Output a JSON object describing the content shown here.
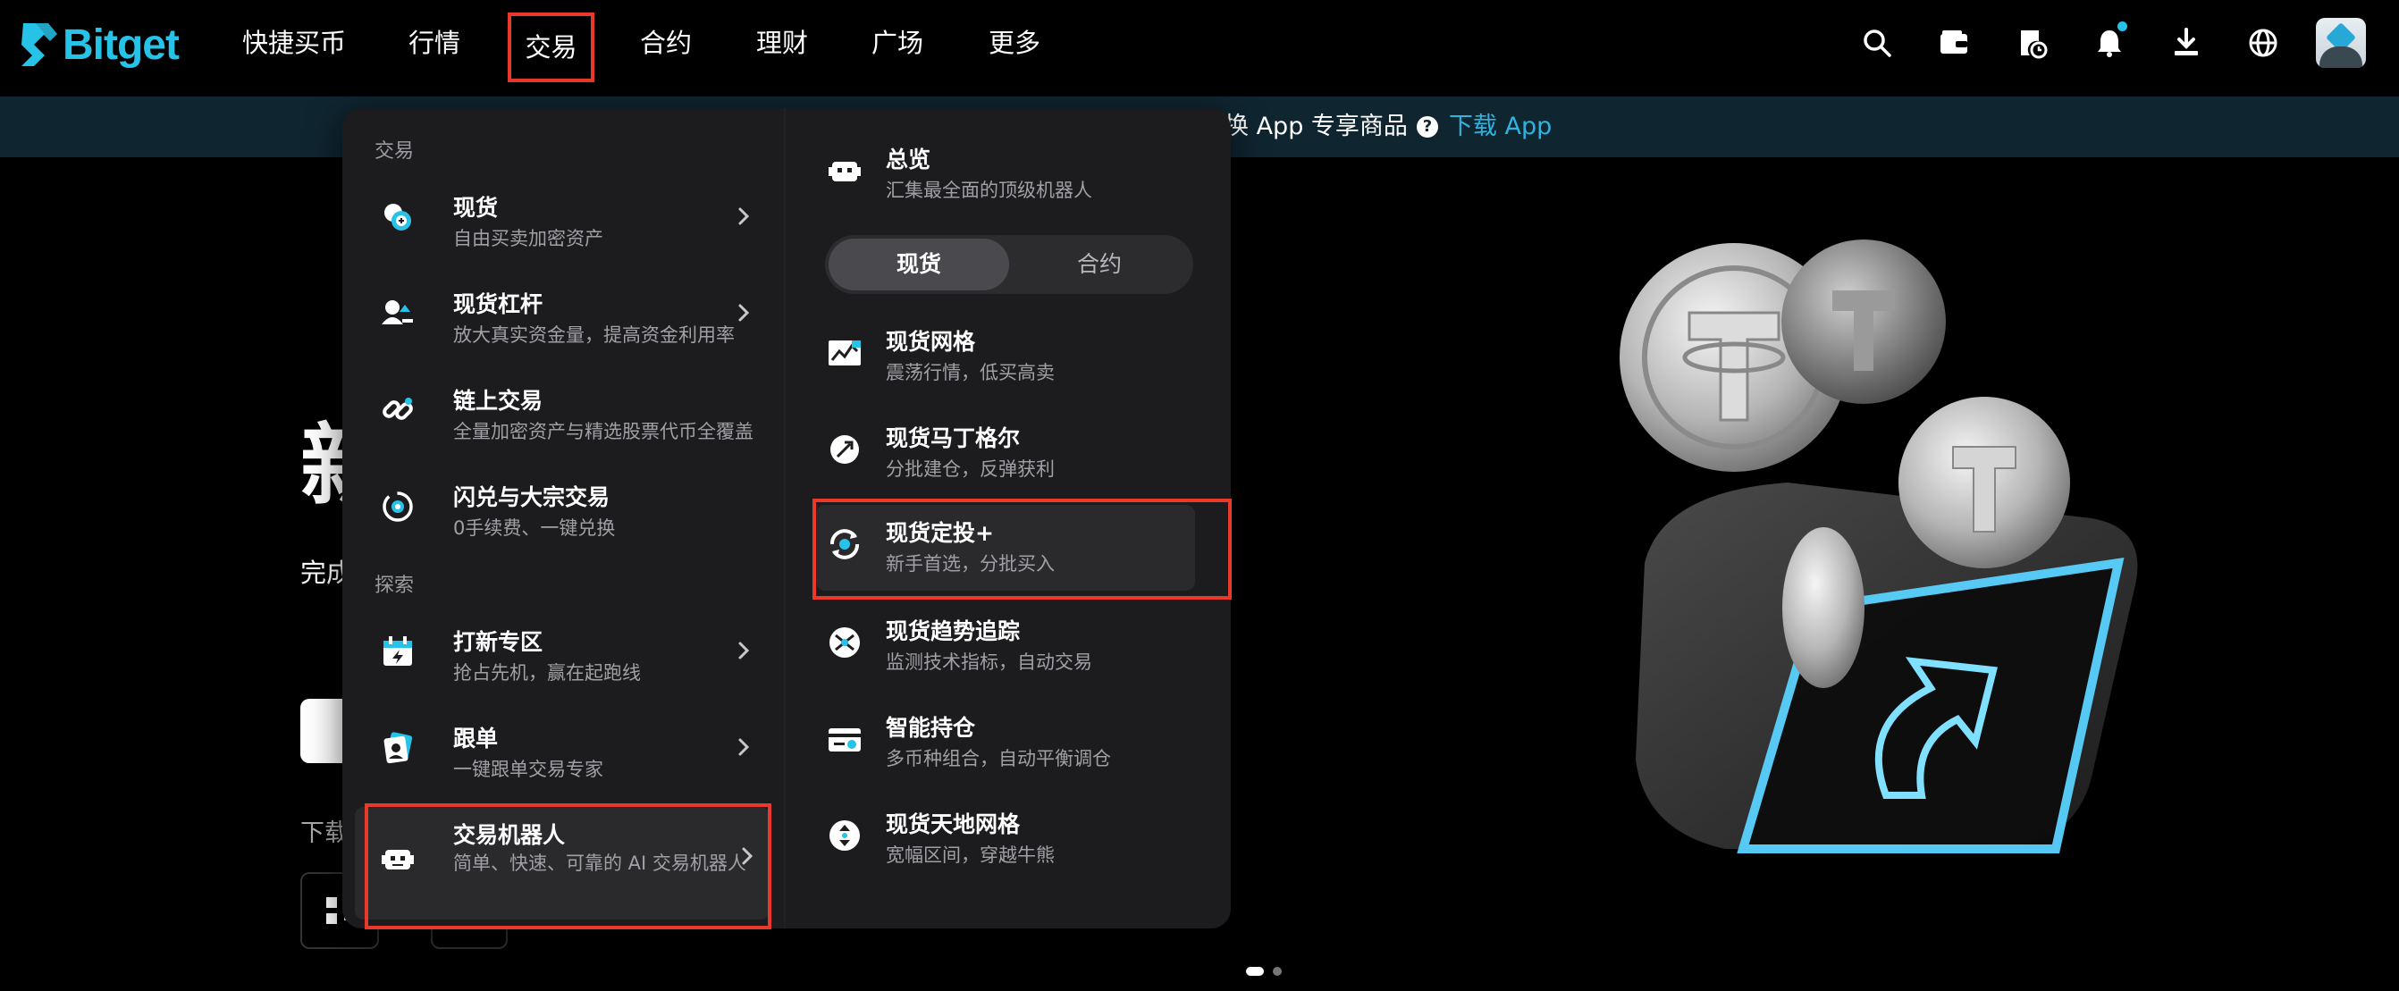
{
  "brand": {
    "name": "Bitget",
    "accent": "#27c2e8",
    "highlight": "#e8392b"
  },
  "nav": {
    "items": [
      "快捷买币",
      "行情",
      "交易",
      "合约",
      "理财",
      "广场",
      "更多"
    ],
    "active": "交易",
    "icons": [
      "search-icon",
      "wallet-icon",
      "history-icon",
      "bell-icon",
      "download-icon",
      "globe-icon",
      "avatar"
    ]
  },
  "banner": {
    "text": "换 App 专享商品",
    "link": "下载 App"
  },
  "hero": {
    "title_fragment": "新",
    "subtitle_fragment": "完成",
    "download_fragment": "下载"
  },
  "menu": {
    "left": {
      "section_trade": "交易",
      "section_explore": "探索",
      "items": [
        {
          "title": "现货",
          "desc": "自由买卖加密资产",
          "icon": "spot-icon",
          "chevron": true
        },
        {
          "title": "现货杠杆",
          "desc": "放大真实资金量，提高资金利用率",
          "icon": "margin-icon",
          "chevron": true
        },
        {
          "title": "链上交易",
          "desc": "全量加密资产与精选股票代币全覆盖",
          "icon": "onchain-icon",
          "chevron": false
        },
        {
          "title": "闪兑与大宗交易",
          "desc": "0手续费、一键兑换",
          "icon": "convert-icon",
          "chevron": false
        },
        {
          "title": "打新专区",
          "desc": "抢占先机，赢在起跑线",
          "icon": "launchpad-icon",
          "chevron": true
        },
        {
          "title": "跟单",
          "desc": "一键跟单交易专家",
          "icon": "copy-trade-icon",
          "chevron": true
        },
        {
          "title": "交易机器人",
          "desc": "简单、快速、可靠的 AI 交易机器人",
          "icon": "bot-icon",
          "chevron": true
        }
      ]
    },
    "right": {
      "overview": {
        "title": "总览",
        "desc": "汇集最全面的顶级机器人"
      },
      "tabs": [
        "现货",
        "合约"
      ],
      "active_tab": "现货",
      "items": [
        {
          "title": "现货网格",
          "desc": "震荡行情，低买高卖",
          "icon": "grid-icon"
        },
        {
          "title": "现货马丁格尔",
          "desc": "分批建仓，反弹获利",
          "icon": "martingale-icon"
        },
        {
          "title": "现货定投+",
          "desc": "新手首选，分批买入",
          "icon": "dca-icon"
        },
        {
          "title": "现货趋势追踪",
          "desc": "监测技术指标，自动交易",
          "icon": "trend-icon"
        },
        {
          "title": "智能持仓",
          "desc": "多币种组合，自动平衡调仓",
          "icon": "portfolio-icon"
        },
        {
          "title": "现货天地网格",
          "desc": "宽幅区间，穿越牛熊",
          "icon": "infinity-grid-icon"
        }
      ]
    }
  }
}
